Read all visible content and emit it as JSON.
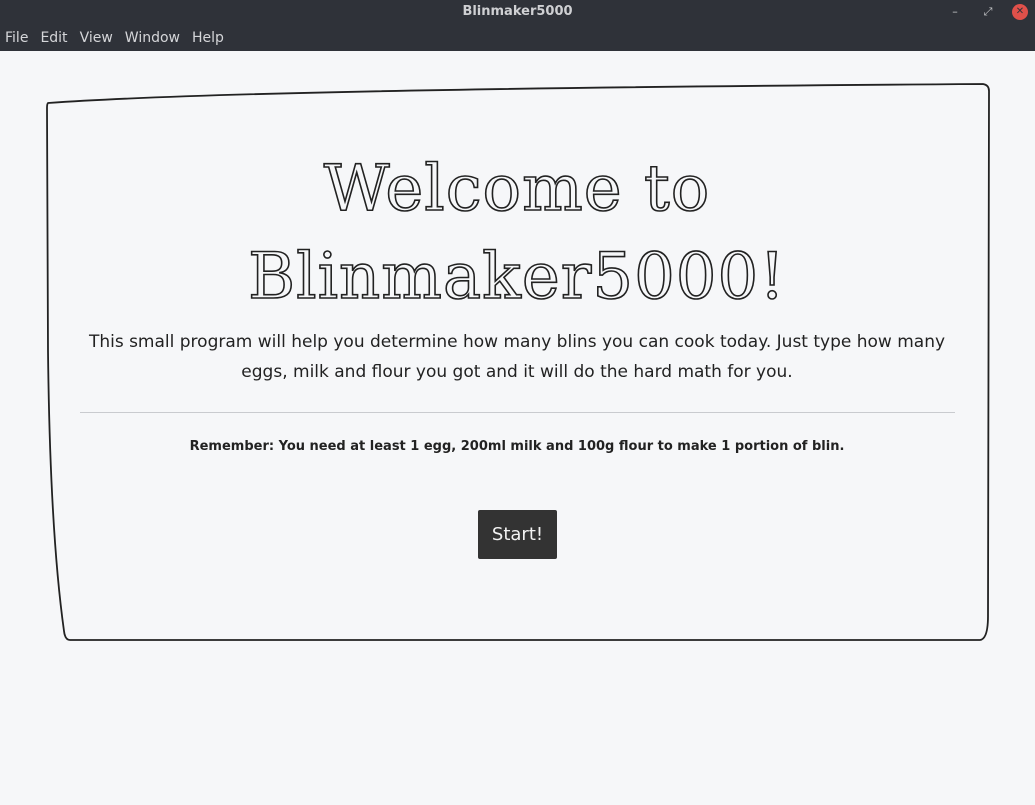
{
  "window": {
    "title": "Blinmaker5000",
    "minimize_glyph": "–",
    "maximize_glyph": "⤢",
    "close_glyph": "✕"
  },
  "menu": {
    "items": [
      {
        "label": "File"
      },
      {
        "label": "Edit"
      },
      {
        "label": "View"
      },
      {
        "label": "Window"
      },
      {
        "label": "Help"
      }
    ]
  },
  "main": {
    "heading_line1": "Welcome to",
    "heading_line2": "Blinmaker5000!",
    "intro": "This small program will help you determine how many blins you can cook today. Just type how many eggs, milk and flour you got and it will do the hard math for you.",
    "remember": "Remember: You need at least 1 egg, 200ml milk and 100g flour to make 1 portion of blin.",
    "start_label": "Start!"
  },
  "colors": {
    "titlebar": "#2f3239",
    "background": "#f6f7f9",
    "button": "#333333",
    "close": "#e0504a"
  }
}
